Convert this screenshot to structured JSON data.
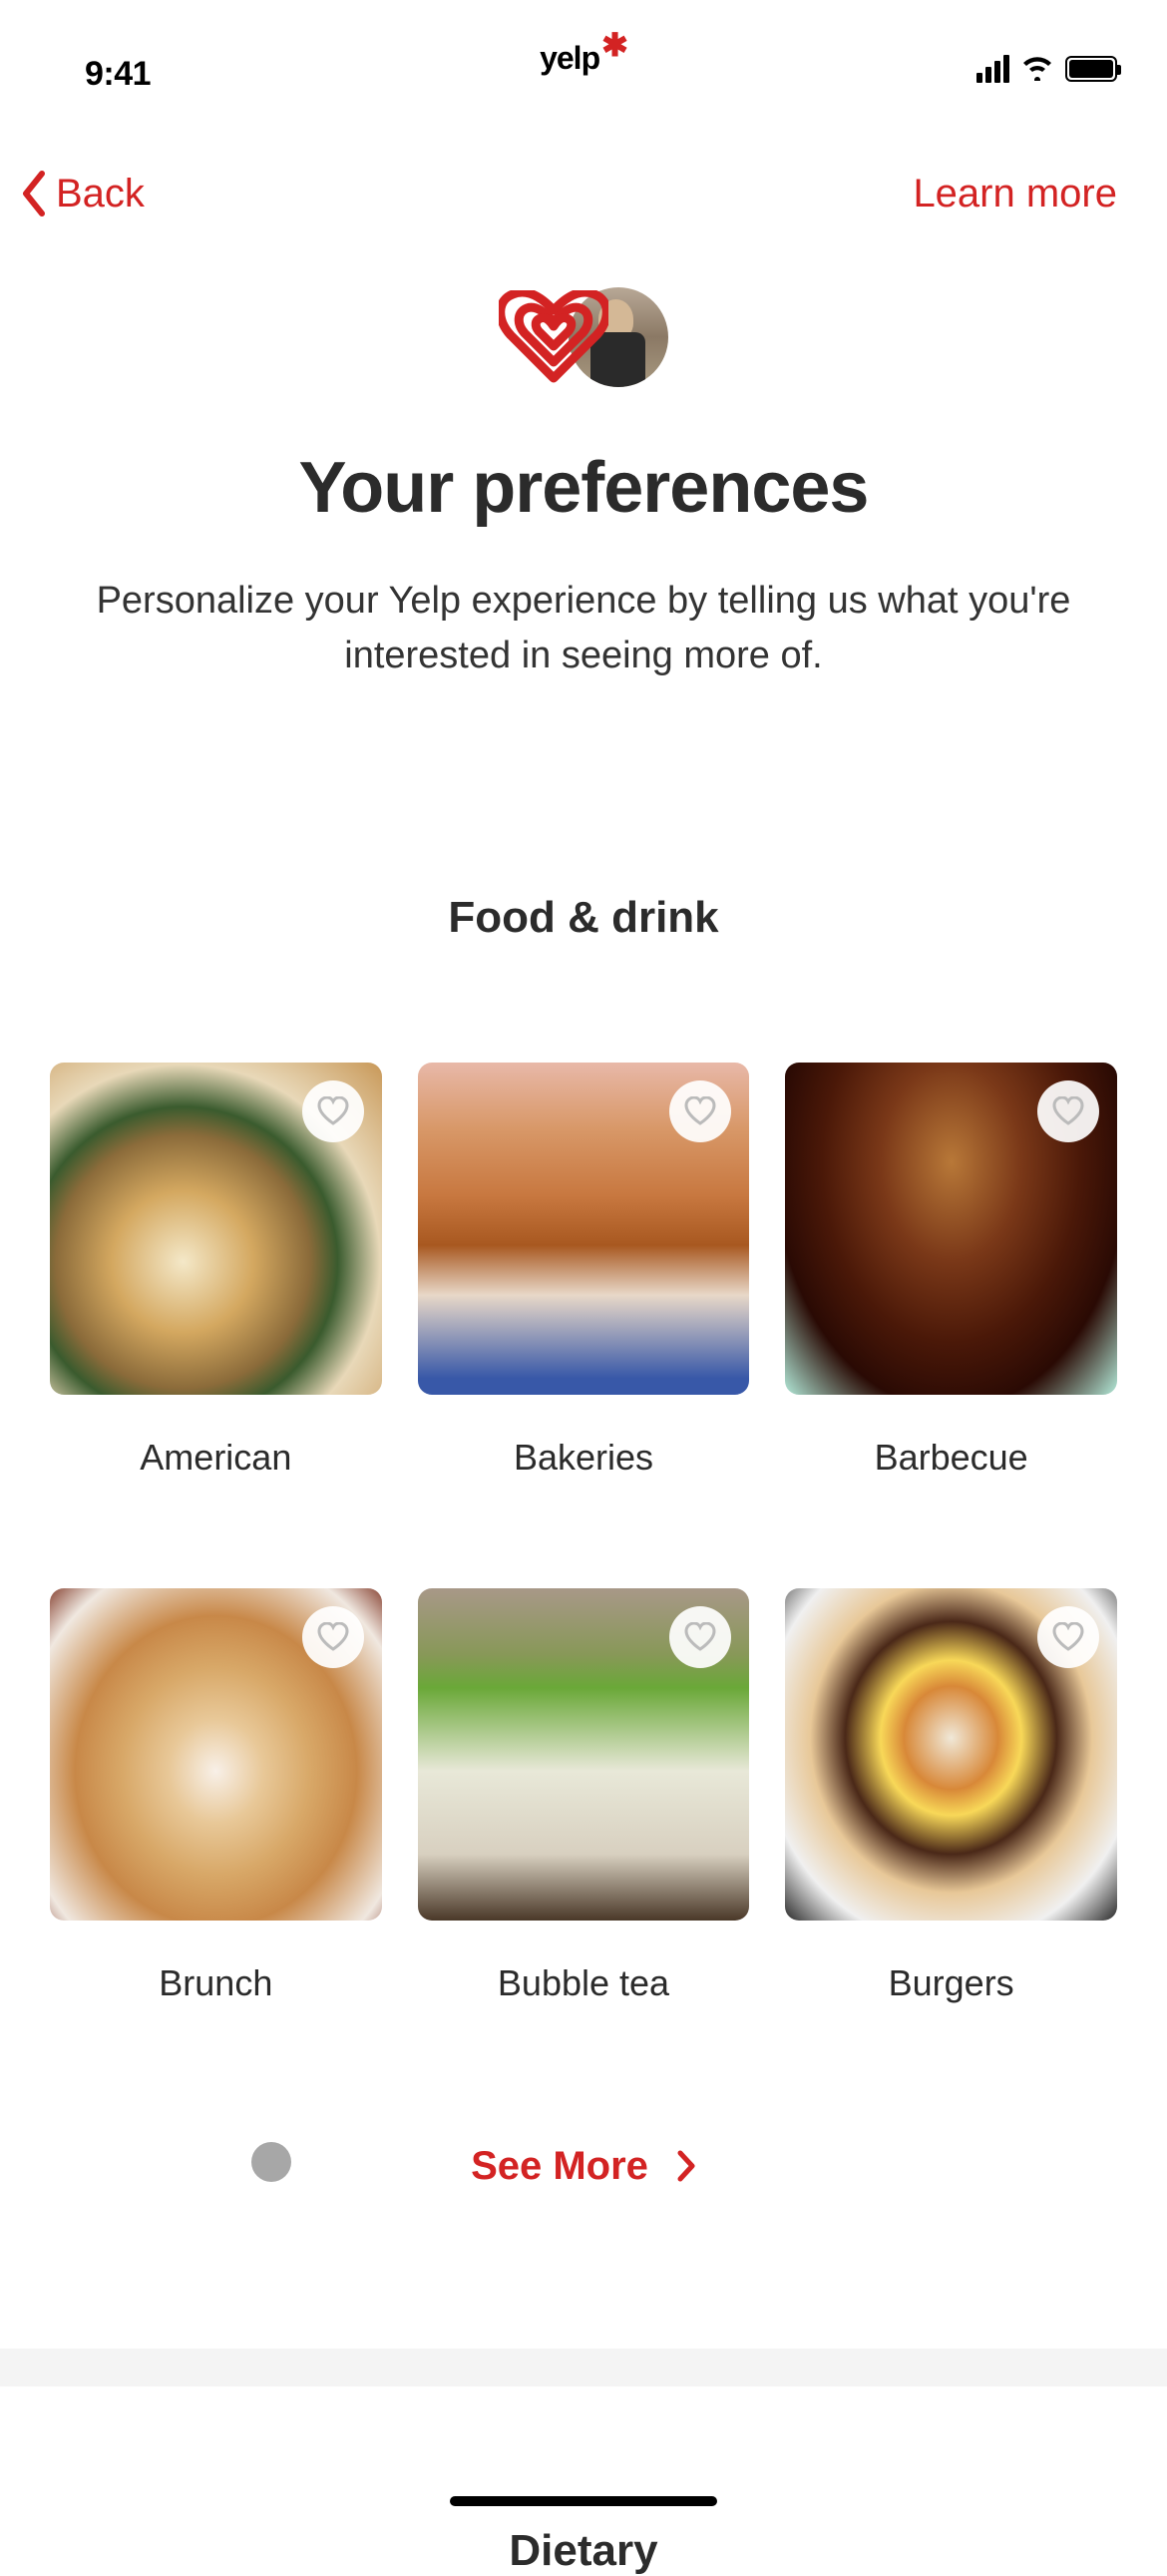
{
  "status": {
    "time": "9:41",
    "logo_text": "yelp"
  },
  "nav": {
    "back_label": "Back",
    "learn_more_label": "Learn more"
  },
  "hero": {
    "title": "Your preferences",
    "subtitle": "Personalize your Yelp experience by telling us what you're interested in seeing more of."
  },
  "sections": {
    "food_drink": {
      "title": "Food & drink",
      "items": [
        {
          "label": "American",
          "tile_class": "tile-american"
        },
        {
          "label": "Bakeries",
          "tile_class": "tile-bakeries"
        },
        {
          "label": "Barbecue",
          "tile_class": "tile-barbecue"
        },
        {
          "label": "Brunch",
          "tile_class": "tile-brunch"
        },
        {
          "label": "Bubble tea",
          "tile_class": "tile-bubbletea"
        },
        {
          "label": "Burgers",
          "tile_class": "tile-burgers"
        }
      ],
      "see_more_label": "See More"
    },
    "dietary": {
      "title": "Dietary"
    }
  },
  "colors": {
    "brand_red": "#d32323"
  }
}
